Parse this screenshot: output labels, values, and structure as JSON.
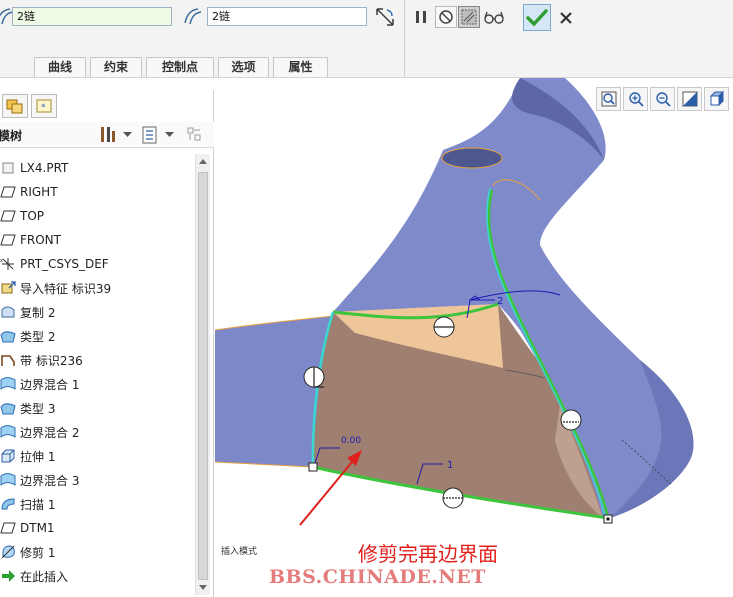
{
  "dashboard": {
    "chain1_value": "2链",
    "chain2_value": "2链",
    "tabs": [
      "曲线",
      "约束",
      "控制点",
      "选项",
      "属性"
    ]
  },
  "left_panel": {
    "tree_title": "型模树",
    "tree_items": [
      {
        "label": "LX4.PRT",
        "icon": "part-icon"
      },
      {
        "label": "RIGHT",
        "icon": "datum-plane-icon"
      },
      {
        "label": "TOP",
        "icon": "datum-plane-icon"
      },
      {
        "label": "FRONT",
        "icon": "datum-plane-icon"
      },
      {
        "label": "PRT_CSYS_DEF",
        "icon": "csys-icon"
      },
      {
        "label": "导入特征 标识39",
        "icon": "import-feature-icon"
      },
      {
        "label": "复制 2",
        "icon": "copy-icon"
      },
      {
        "label": "类型 2",
        "icon": "surface-icon"
      },
      {
        "label": "带 标识236",
        "icon": "ribbon-icon"
      },
      {
        "label": "边界混合 1",
        "icon": "boundary-blend-icon"
      },
      {
        "label": "类型 3",
        "icon": "surface-icon"
      },
      {
        "label": "边界混合 2",
        "icon": "boundary-blend-icon"
      },
      {
        "label": "拉伸 1",
        "icon": "extrude-icon"
      },
      {
        "label": "边界混合 3",
        "icon": "boundary-blend-icon"
      },
      {
        "label": "扫描 1",
        "icon": "sweep-icon"
      },
      {
        "label": "DTM1",
        "icon": "datum-plane-icon"
      },
      {
        "label": "修剪 1",
        "icon": "trim-icon"
      },
      {
        "label": "在此插入",
        "icon": "insert-here-arrow-icon"
      }
    ]
  },
  "viewport": {
    "labels": {
      "curve1": "1",
      "curve2": "2",
      "value": "0.00"
    },
    "status": "插入模式",
    "annotation": "修剪完再边界面",
    "watermark": "BBS.CHINADE.NET"
  },
  "colors": {
    "surface_blue": "#7d88c8",
    "boundary_fill": "#a08070",
    "boundary_highlight": "#eec69a",
    "chain_green": "#3dc43d",
    "chain_cyan": "#38d8d0",
    "accent_red": "#e0201c",
    "ok_green": "#2e9e2e"
  }
}
